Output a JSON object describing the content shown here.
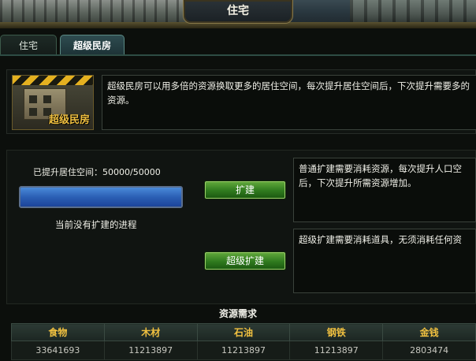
{
  "window": {
    "title": "住宅"
  },
  "tabs": [
    {
      "label": "住宅"
    },
    {
      "label": "超级民房",
      "active": true
    }
  ],
  "intro": {
    "portrait_label": "超级民房",
    "text": "超级民房可以用多倍的资源换取更多的居住空间，每次提升居住空间后，下次提升需要多的资源。"
  },
  "expansion": {
    "space_label": "已提升居住空间：50000/50000",
    "progress_fraction": 1.0,
    "status_text": "当前没有扩建的进程",
    "expand_button": "扩建",
    "super_expand_button": "超级扩建",
    "normal_desc": "普通扩建需要消耗资源，每次提升人口空后，下次提升所需资源增加。",
    "super_desc": "超级扩建需要消耗道具，无须消耗任何资"
  },
  "resources": {
    "title": "资源需求",
    "columns": [
      "食物",
      "木材",
      "石油",
      "钢铁",
      "金钱"
    ],
    "values": [
      "33641693",
      "11213897",
      "11213897",
      "11213897",
      "2803474"
    ]
  },
  "colors": {
    "accent_gold": "#f0c040",
    "button_green": "#2f7a1e",
    "progress_blue": "#2b5fb4"
  }
}
